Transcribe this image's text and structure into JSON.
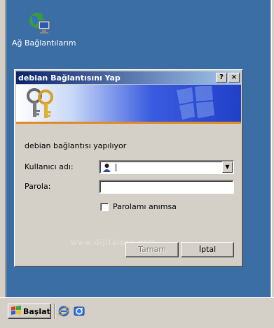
{
  "desktop": {
    "icon_label": "Ağ Bağlantılarım",
    "icon": "network-connections-icon"
  },
  "dialog": {
    "title": "debian Bağlantısını Yap",
    "help_button": "?",
    "close_button": "×",
    "status": "debian bağlantısı yapılıyor",
    "username_label": "Kullanıcı adı:",
    "username_value": "",
    "password_label": "Parola:",
    "remember_label": "Parolamı anımsa",
    "remember_checked": false,
    "ok_label": "Tamam",
    "cancel_label": "İptal",
    "watermark": "www.dijitalpro.com"
  },
  "taskbar": {
    "start_label": "Başlat"
  },
  "colors": {
    "desktop": "#3a6ea5",
    "titlebar_start": "#0a246a",
    "titlebar_end": "#a6caf0",
    "banner_stripe": "#e08a28"
  }
}
